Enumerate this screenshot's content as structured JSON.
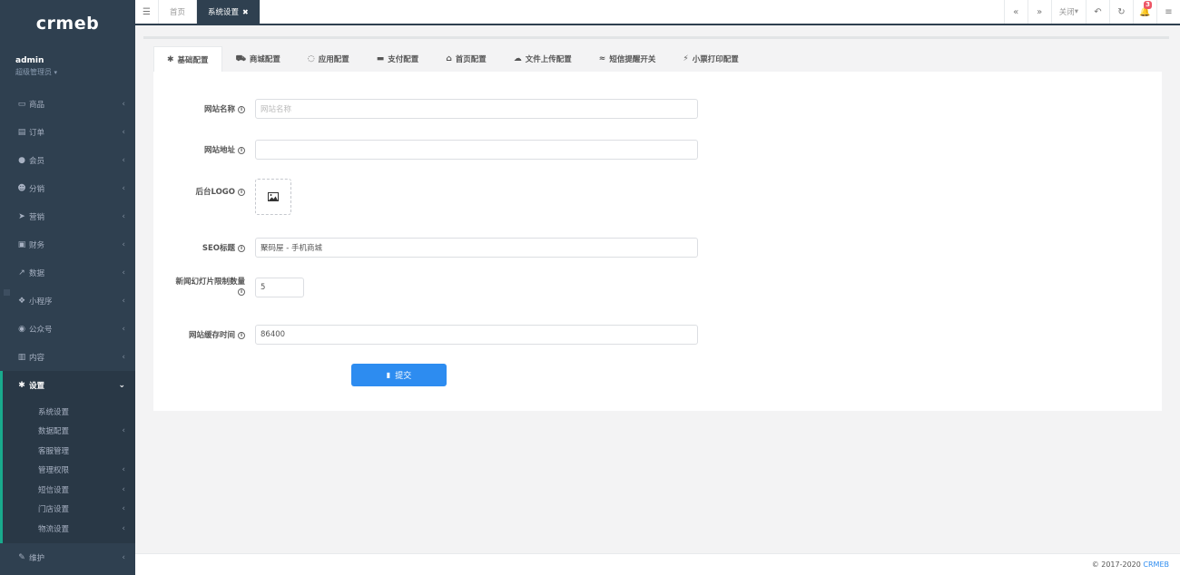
{
  "app": {
    "logo": "crmeb"
  },
  "profile": {
    "name": "admin",
    "role": "超级管理员"
  },
  "nav": [
    {
      "label": "商品",
      "icon": "laptop-icon",
      "glyph": "▭"
    },
    {
      "label": "订单",
      "icon": "file-icon",
      "glyph": "▤"
    },
    {
      "label": "会员",
      "icon": "user-icon",
      "glyph": "●"
    },
    {
      "label": "分销",
      "icon": "users-icon",
      "glyph": "☻"
    },
    {
      "label": "营销",
      "icon": "send-icon",
      "glyph": "➤"
    },
    {
      "label": "财务",
      "icon": "money-icon",
      "glyph": "▣"
    },
    {
      "label": "数据",
      "icon": "chart-icon",
      "glyph": "↗"
    },
    {
      "label": "小程序",
      "icon": "cubes-icon",
      "glyph": "❖"
    },
    {
      "label": "公众号",
      "icon": "wechat-icon",
      "glyph": "◉"
    },
    {
      "label": "内容",
      "icon": "book-icon",
      "glyph": "▥"
    }
  ],
  "active_nav": {
    "label": "设置",
    "icon": "gear-icon",
    "glyph": "✱",
    "arrow": "⌄"
  },
  "subnav": [
    {
      "label": "系统设置",
      "has_arrow": false
    },
    {
      "label": "数据配置",
      "has_arrow": true
    },
    {
      "label": "客服管理",
      "has_arrow": false
    },
    {
      "label": "管理权限",
      "has_arrow": true
    },
    {
      "label": "短信设置",
      "has_arrow": true
    },
    {
      "label": "门店设置",
      "has_arrow": true
    },
    {
      "label": "物流设置",
      "has_arrow": true
    }
  ],
  "nav_bottom": {
    "label": "维护",
    "icon": "wrench-icon",
    "glyph": "✎"
  },
  "topbar": {
    "tabs": [
      {
        "label": "首页"
      },
      {
        "label": "系统设置"
      }
    ],
    "close_label": "关闭",
    "notification_count": "3"
  },
  "config_tabs": [
    {
      "label": "基础配置",
      "icon": "gear-icon",
      "glyph": "✱"
    },
    {
      "label": "商城配置",
      "icon": "cart-icon",
      "glyph": "⛟"
    },
    {
      "label": "应用配置",
      "icon": "whatsapp-icon",
      "glyph": "◌"
    },
    {
      "label": "支付配置",
      "icon": "credit-card-icon",
      "glyph": "▬"
    },
    {
      "label": "首页配置",
      "icon": "home-icon",
      "glyph": "⌂"
    },
    {
      "label": "文件上传配置",
      "icon": "cloud-upload-icon",
      "glyph": "☁"
    },
    {
      "label": "短信提醒开关",
      "icon": "rss-icon",
      "glyph": "≈"
    },
    {
      "label": "小票打印配置",
      "icon": "plug-icon",
      "glyph": "⚡"
    }
  ],
  "form": {
    "site_name": {
      "label": "网站名称",
      "value": "",
      "placeholder": "网站名称"
    },
    "site_url": {
      "label": "网站地址",
      "value": ""
    },
    "admin_logo": {
      "label": "后台LOGO"
    },
    "seo_title": {
      "label": "SEO标题",
      "value": "聚码屋 - 手机商城"
    },
    "news_slide_limit": {
      "label": "新闻幻灯片限制数量",
      "value": "5"
    },
    "cache_time": {
      "label": "网站缓存时间",
      "value": "86400"
    },
    "submit_label": "提交"
  },
  "footer": {
    "copyright": "© 2017-2020",
    "brand": "CRMEB"
  }
}
